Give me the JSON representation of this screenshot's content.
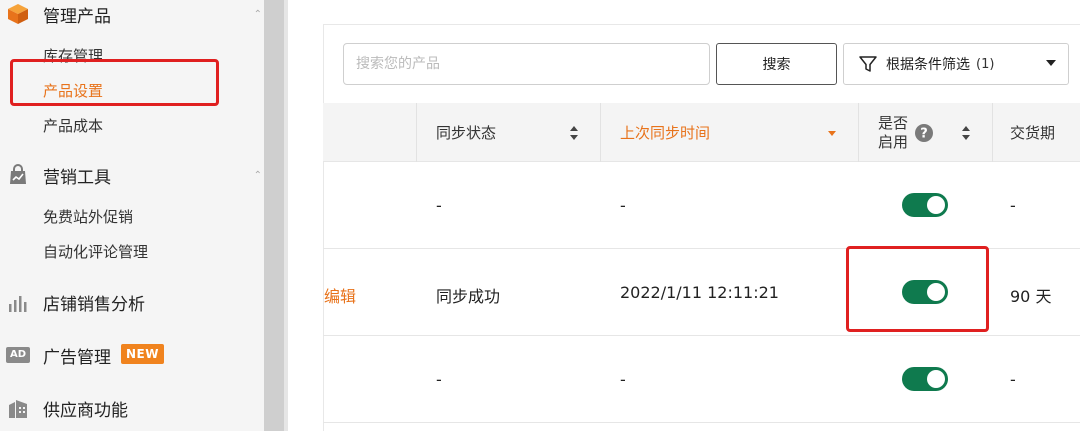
{
  "sidebar": {
    "sections": [
      {
        "label": "管理产品",
        "icon": "box-icon",
        "items": [
          "库存管理",
          "产品设置",
          "产品成本"
        ],
        "active_item": "产品设置"
      },
      {
        "label": "营销工具",
        "icon": "bag-chart-icon",
        "items": [
          "免费站外促销",
          "自动化评论管理"
        ]
      },
      {
        "label": "店铺销售分析",
        "icon": "bar-chart-icon"
      },
      {
        "label": "广告管理",
        "icon": "ad-icon",
        "icon_text": "AD",
        "badge": "NEW"
      },
      {
        "label": "供应商功能",
        "icon": "building-icon"
      }
    ]
  },
  "toolbar": {
    "search_placeholder": "搜索您的产品",
    "search_value": "",
    "search_button": "搜索",
    "filter_label": "根据条件筛选",
    "filter_count": "(1)"
  },
  "table": {
    "headers": {
      "sync_status": "同步状态",
      "last_sync": "上次同步时间",
      "enabled_line1": "是否",
      "enabled_line2": "启用",
      "lead_time": "交货期"
    },
    "sort_active": "last_sync",
    "rows": [
      {
        "action": "",
        "sync_status": "-",
        "last_sync": "-",
        "enabled": true,
        "lead_time": "-"
      },
      {
        "action": "编辑",
        "sync_status": "同步成功",
        "last_sync": "2022/1/11 12:11:21",
        "enabled": true,
        "lead_time": "90 天"
      },
      {
        "action": "",
        "sync_status": "-",
        "last_sync": "-",
        "enabled": true,
        "lead_time": "-"
      }
    ]
  },
  "colors": {
    "accent": "#e8731b",
    "toggle_on": "#0f7a4e",
    "highlight": "#e02020",
    "badge": "#f0831e"
  }
}
